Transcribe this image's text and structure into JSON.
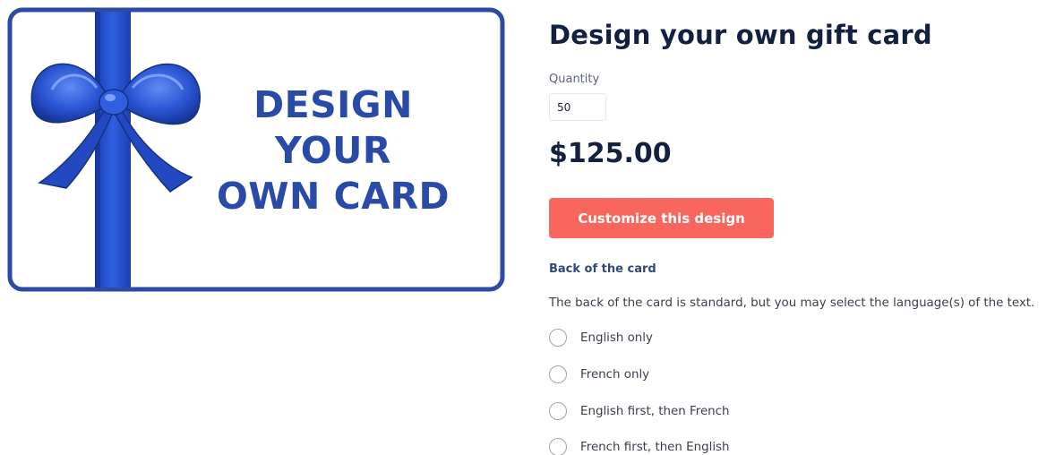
{
  "card_image": {
    "lines": [
      "DESIGN",
      "YOUR",
      "OWN CARD"
    ],
    "border_color": "#2e4aa3",
    "ribbon_color": "#1f47c4",
    "text_color": "#2a4aa8"
  },
  "product": {
    "title": "Design your own gift card",
    "quantity_label": "Quantity",
    "quantity_value": "50",
    "price": "$125.00",
    "customize_button": "Customize this design"
  },
  "back_of_card": {
    "heading": "Back of the card",
    "description": "The back of the card is standard, but you may select the language(s) of the text.",
    "options": [
      {
        "label": "English only",
        "selected": false
      },
      {
        "label": "French only",
        "selected": false
      },
      {
        "label": "English first, then French",
        "selected": false
      },
      {
        "label": "French first, then English",
        "selected": false
      }
    ]
  },
  "colors": {
    "accent_button": "#f9665e",
    "heading_text": "#13203f",
    "subheading_text": "#34477c"
  }
}
